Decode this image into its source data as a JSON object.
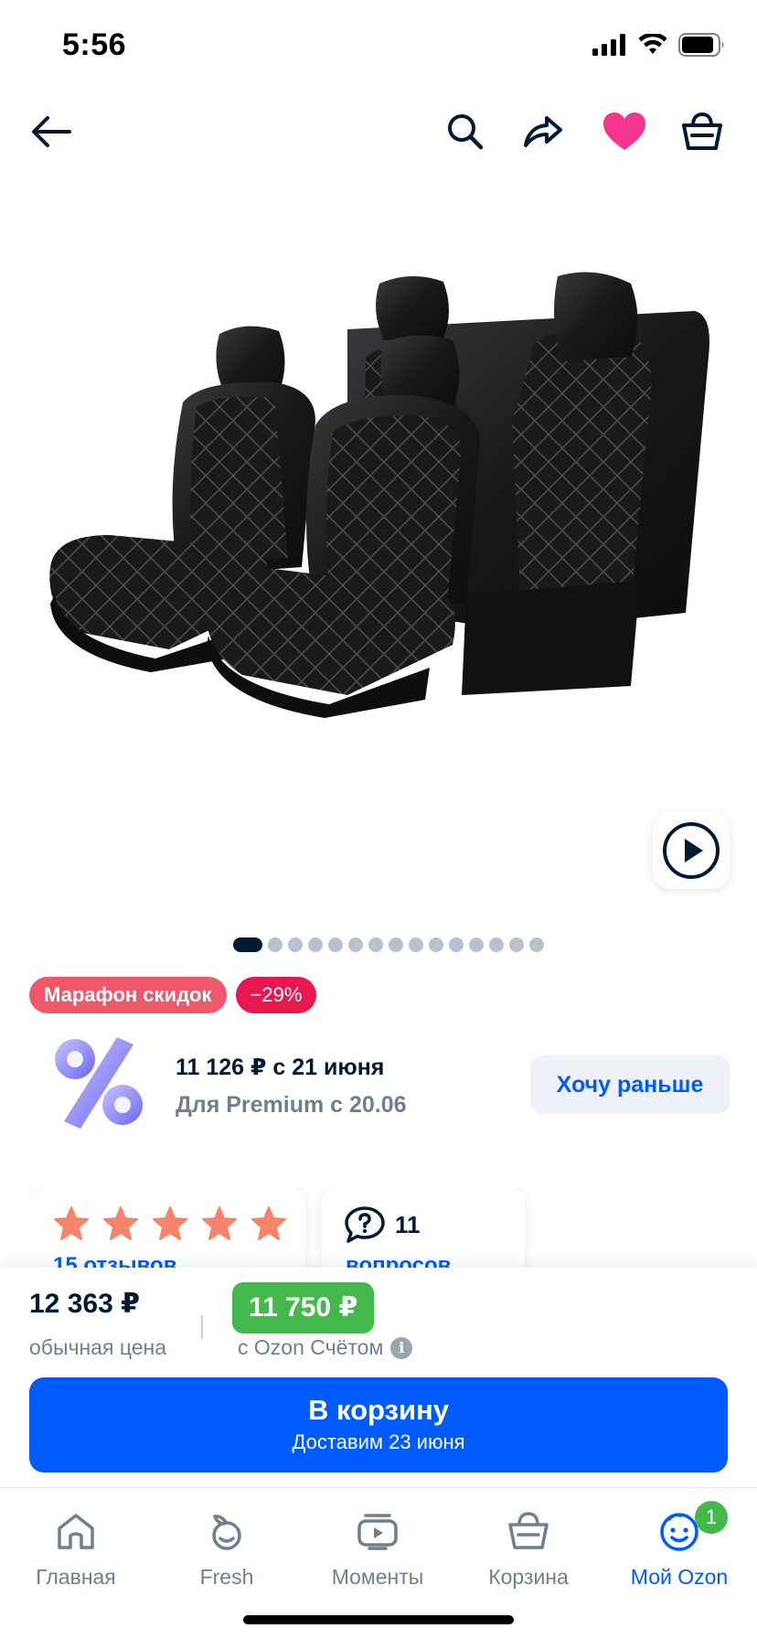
{
  "status_bar": {
    "time": "5:56"
  },
  "header": {
    "icons": [
      "back-arrow-icon",
      "search-icon",
      "share-icon",
      "heart-icon",
      "cart-icon"
    ]
  },
  "gallery": {
    "image_count": 15,
    "active_index": 0
  },
  "badges": {
    "sale": "Марафон скидок",
    "discount": "−29%"
  },
  "promo": {
    "price_line": "11 126 ₽ с 21 июня",
    "premium_line": "Для Premium с 20.06",
    "button": "Хочу раньше"
  },
  "reviews": {
    "stars": 5,
    "link": "15 отзывов"
  },
  "questions": {
    "count": "11",
    "link": "вопросов"
  },
  "price": {
    "regular": "12 363 ₽",
    "regular_label": "обычная цена",
    "card": "11 750 ₽",
    "card_label": "с Ozon Счётом"
  },
  "cart_button": {
    "title": "В корзину",
    "subtitle": "Доставим 23 июня"
  },
  "tabbar": {
    "items": [
      {
        "label": "Главная",
        "icon": "home-icon"
      },
      {
        "label": "Fresh",
        "icon": "fresh-icon"
      },
      {
        "label": "Моменты",
        "icon": "moments-icon"
      },
      {
        "label": "Корзина",
        "icon": "basket-icon"
      },
      {
        "label": "Мой Ozon",
        "icon": "profile-icon",
        "badge": "1"
      }
    ]
  },
  "colors": {
    "accent": "#005bff",
    "price_green": "#42b94a",
    "sale_badge": "#f1576b",
    "discount_badge": "#e8174f",
    "heart": "#f1117e",
    "stars": "#f5846b"
  }
}
